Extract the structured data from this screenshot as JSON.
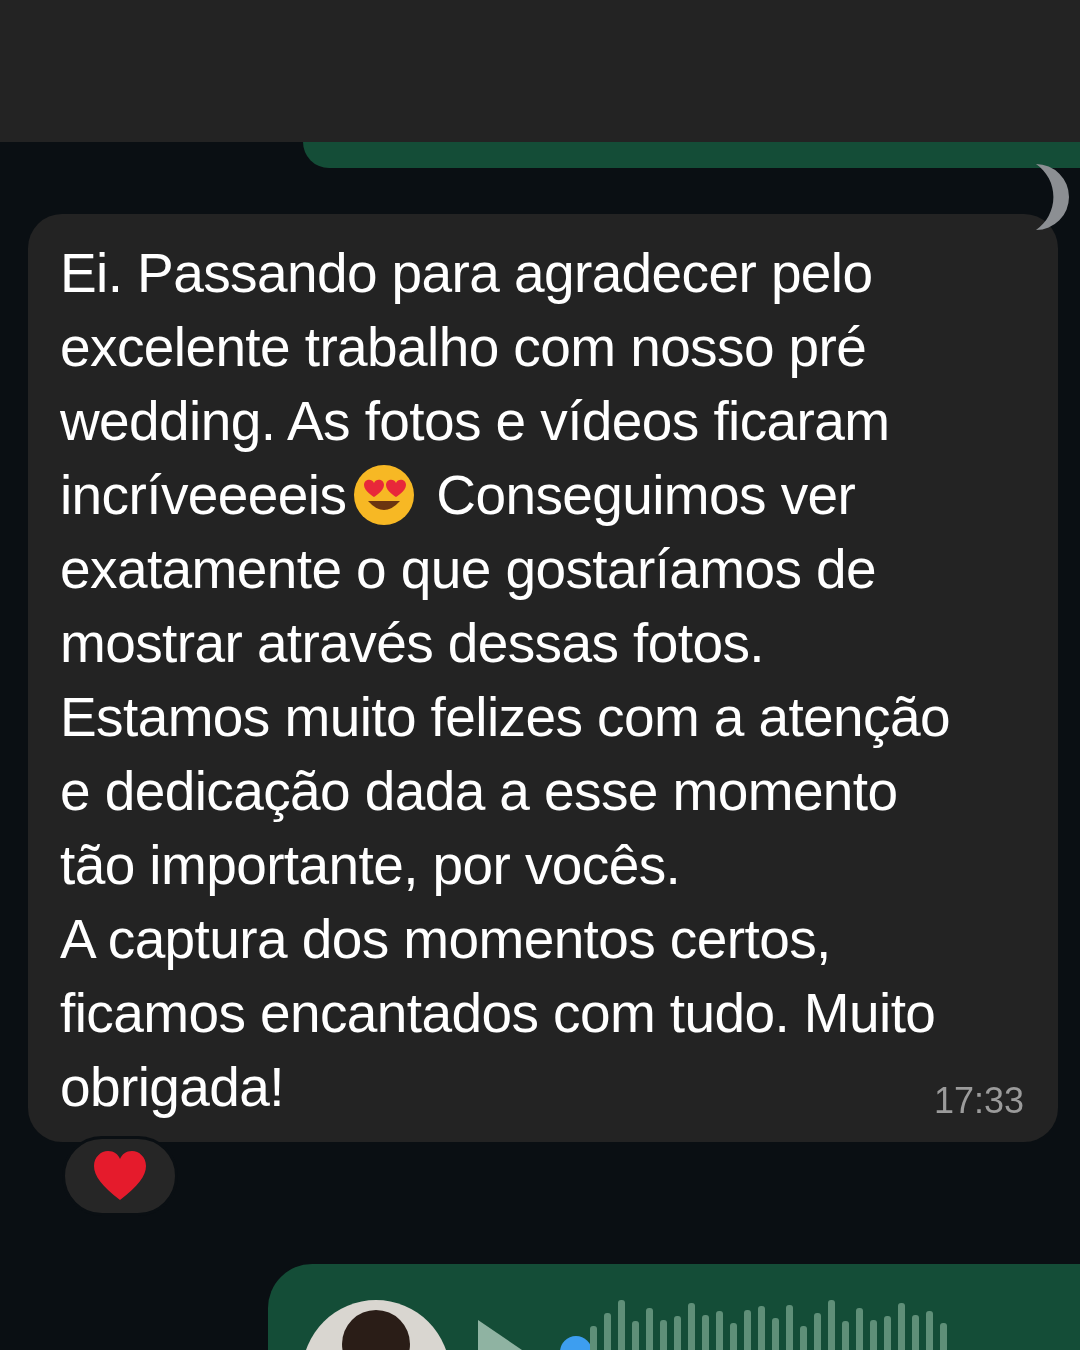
{
  "message": {
    "lines": [
      {
        "text": "Ei. Passando para agradecer pelo"
      },
      {
        "text": "excelente trabalho com nosso pré"
      },
      {
        "text": "wedding. As fotos e vídeos ficaram"
      },
      {
        "text": "incríveeeeis",
        "emoji_after": true,
        "text_after": "Conseguimos ver"
      },
      {
        "text": "exatamente o que gostaríamos de"
      },
      {
        "text": "mostrar através dessas fotos."
      },
      {
        "text": "Estamos muito felizes com a atenção"
      },
      {
        "text": "e dedicação dada a esse momento"
      },
      {
        "text": "tão importante, por vocês."
      },
      {
        "text": "A captura dos momentos certos,"
      },
      {
        "text": "ficamos encantados com tudo. Muito"
      },
      {
        "text": "obrigada!"
      }
    ],
    "time": "17:33"
  }
}
